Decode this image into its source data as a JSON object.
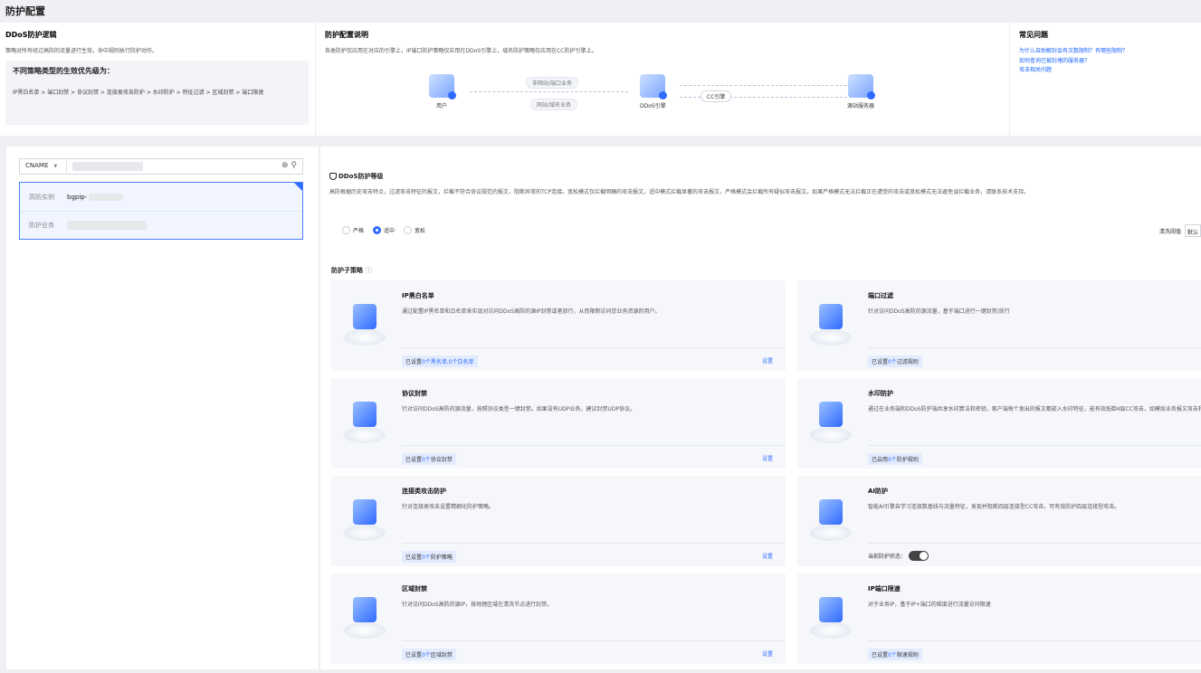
{
  "page_title": "防护配置",
  "logic": {
    "title": "DDoS防护逻辑",
    "desc": "策略对所有经过高防的流量进行生效，命中规则执行防护动作。",
    "priority_title": "不同策略类型的生效优先级为：",
    "priority_text": "IP黑白名单 > 端口封禁 > 协议封禁 > 连接类攻击防护 > 水印防护 > 特征过滤 > 区域封禁 > 端口限速"
  },
  "config_desc": {
    "title": "防护配置说明",
    "desc": "各类防护仅应用在对应的引擎上，IP端口防护策略仅应用在DDoS引擎上，域名防护策略仅应用在CC防护引擎上。",
    "flow": {
      "user": "用户",
      "ddos": "DDoS引擎",
      "origin": "源站服务器",
      "tag_non_web": "非网站/端口业务",
      "tag_web": "网站/域名业务",
      "tag_cc": "CC引擎"
    }
  },
  "faq": {
    "title": "常见问题",
    "links": [
      "为什么自助解封会有次数限制？有哪些限制？",
      "如何查询已被封堵的服务器？",
      "攻击相关问题"
    ]
  },
  "search": {
    "type": "CNAME"
  },
  "instance": {
    "label_instance": "高防实例",
    "value_instance": "bgpip-",
    "label_business": "防护业务"
  },
  "level": {
    "title": "DDoS防护等级",
    "desc": "高防根据历史攻击特点，过滤攻击特征的报文，拦截不符合协议规范的报文，阻断异常的TCP连接。宽松模式仅拦截明确的攻击报文，适中模式拦截显著的攻击报文，严格模式会拦截所有疑似攻击报文。如果严格模式无法拦截正在遭受的攻击或宽松模式无法避免误拦截业务，请联系技术支持。",
    "options": [
      "严格",
      "适中",
      "宽松"
    ],
    "clean_label": "清洗阈值",
    "clean_value": "默认"
  },
  "sub": {
    "title": "防护子策略",
    "info": "ⓘ",
    "set_label": "设置",
    "cards": [
      {
        "name": "IP黑白名单",
        "desc": "通过配置IP黑名单和白名单来实现对访问DDoS高防的源IP封禁或者放行，从而限制访问您业务资源的用户。",
        "status_pre": "已设置",
        "status_num": "0个黑名单,0个白名单",
        "status_post": ""
      },
      {
        "name": "端口过滤",
        "desc": "针对访问DDoS高防的源流量，基于端口进行一键封禁/放行",
        "status_pre": "已设置",
        "status_num": "0个",
        "status_post": "过滤规则"
      },
      {
        "name": "协议封禁",
        "desc": "针对访问DDoS高防的源流量，按照协议类型一键封禁。如果没有UDP业务，建议封禁UDP协议。",
        "status_pre": "已设置",
        "status_num": "0个",
        "status_post": "协议封禁"
      },
      {
        "name": "水印防护",
        "desc": "通过在业务端和DDoS防护端共享水印算法和密钥，客户端每个发出的报文都嵌入水印特征，能有效抵御4层CC攻击，如模拟业务报文攻击和重放攻击等。",
        "status_pre": "已启用",
        "status_num": "0个",
        "status_post": "防护规则",
        "edge": "可"
      },
      {
        "name": "连接类攻击防护",
        "desc": "针对连接类攻击设置精细化防护策略。",
        "status_pre": "已设置",
        "status_num": "0个",
        "status_post": "防护策略"
      },
      {
        "name": "AI防护",
        "desc": "智能AI引擎自学习连接数基线与流量特征，发现并阻断四层连接型CC攻击，可有效防护四层连接型攻击。",
        "toggle_label": "当前防护状态："
      },
      {
        "name": "区域封禁",
        "desc": "针对访问DDoS高防的源IP，按地理区域在清洗节点进行封禁。",
        "status_pre": "已设置",
        "status_num": "0个",
        "status_post": "区域封禁"
      },
      {
        "name": "IP端口限速",
        "desc": "对于业务IP，基于IP+端口的维度进行流量访问限速",
        "status_pre": "已设置",
        "status_num": "0个",
        "status_post": "限速规则"
      }
    ]
  }
}
